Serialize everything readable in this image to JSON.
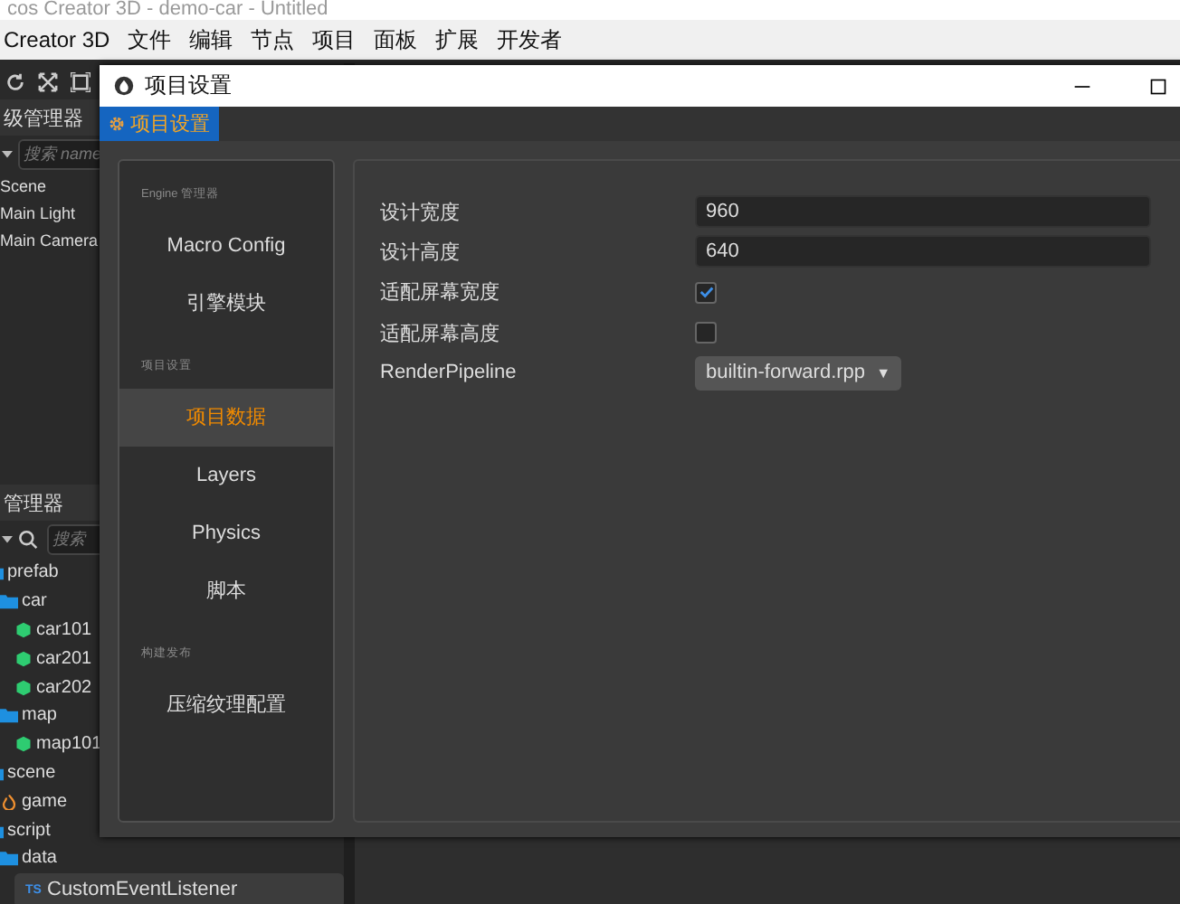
{
  "app_title": "cos Creator 3D - demo-car - Untitled",
  "menu": [
    "Creator 3D",
    "文件",
    "编辑",
    "节点",
    "项目",
    "面板",
    "扩展",
    "开发者"
  ],
  "hierarchy": {
    "title": "级管理器",
    "search_placeholder": "搜索 name",
    "items": [
      "Scene",
      "Main Light",
      "Main Camera"
    ]
  },
  "assets": {
    "title": "管理器",
    "search_placeholder": "搜索",
    "tree": [
      {
        "name": "prefab",
        "kind": "folder",
        "selected": false,
        "children": [
          {
            "name": "car",
            "kind": "folder",
            "selected": false,
            "children": [
              {
                "name": "car101",
                "kind": "prefab",
                "selected": false
              },
              {
                "name": "car201",
                "kind": "prefab",
                "selected": false
              },
              {
                "name": "car202",
                "kind": "prefab",
                "selected": false
              }
            ]
          },
          {
            "name": "map",
            "kind": "folder",
            "selected": false,
            "children": [
              {
                "name": "map101",
                "kind": "prefab",
                "selected": false
              }
            ]
          }
        ]
      },
      {
        "name": "scene",
        "kind": "folder",
        "selected": false,
        "children": [
          {
            "name": "game",
            "kind": "scene",
            "selected": false
          }
        ]
      },
      {
        "name": "script",
        "kind": "folder",
        "selected": false,
        "children": [
          {
            "name": "data",
            "kind": "folder",
            "selected": false,
            "children": [
              {
                "name": "CustomEventListener",
                "kind": "script",
                "badge": "TS",
                "selected": true
              }
            ]
          }
        ]
      }
    ]
  },
  "dialog": {
    "title": "项目设置",
    "tabs": [
      {
        "label": "项目设置",
        "selected": true
      }
    ],
    "nav": [
      {
        "heading": "Engine 管理器",
        "items": [
          {
            "label": "Macro Config",
            "selected": false
          },
          {
            "label": "引擎模块",
            "selected": false
          }
        ]
      },
      {
        "heading": "项目设置",
        "items": [
          {
            "label": "项目数据",
            "selected": true
          },
          {
            "label": "Layers",
            "selected": false
          },
          {
            "label": "Physics",
            "selected": false
          },
          {
            "label": "脚本",
            "selected": false
          }
        ]
      },
      {
        "heading": "构建发布",
        "items": [
          {
            "label": "压缩纹理配置",
            "selected": false
          }
        ]
      }
    ],
    "settings": [
      {
        "kind": "text",
        "label": "设计宽度",
        "value": "960"
      },
      {
        "kind": "text",
        "label": "设计高度",
        "value": "640"
      },
      {
        "kind": "checkbox",
        "label": "适配屏幕宽度",
        "checked": true
      },
      {
        "kind": "checkbox",
        "label": "适配屏幕高度",
        "checked": false
      },
      {
        "kind": "select",
        "label": "RenderPipeline",
        "value": "builtin-forward.rpp",
        "arrow": "▼"
      }
    ]
  }
}
